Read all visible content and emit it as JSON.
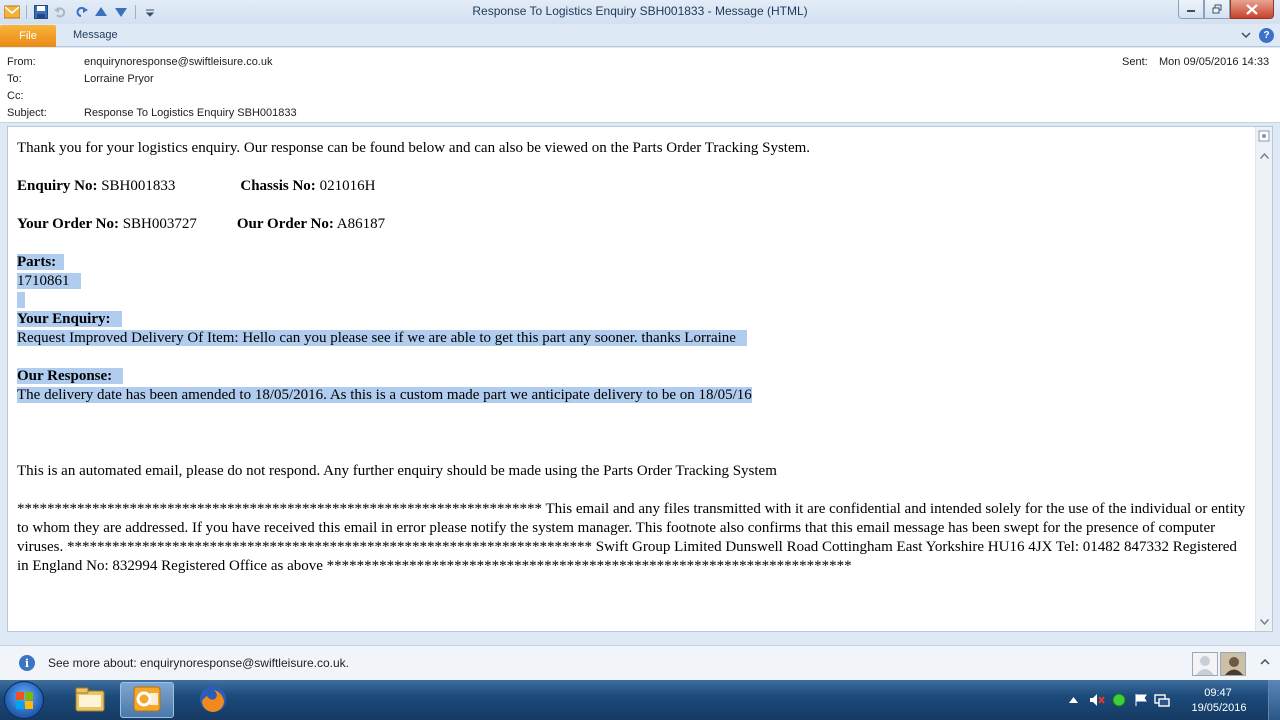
{
  "window": {
    "title": "Response To Logistics Enquiry SBH001833  -  Message (HTML)"
  },
  "ribbon": {
    "file_label": "File",
    "message_label": "Message"
  },
  "header": {
    "from_label": "From:",
    "from_value": "enquirynoresponse@swiftleisure.co.uk",
    "to_label": "To:",
    "to_value": "Lorraine Pryor",
    "cc_label": "Cc:",
    "cc_value": "",
    "subject_label": "Subject:",
    "subject_value": "Response To Logistics Enquiry SBH001833",
    "sent_label": "Sent:",
    "sent_value": "Mon 09/05/2016 14:33"
  },
  "body": {
    "intro": "Thank you for your logistics enquiry. Our response can be found below and can also be viewed on the Parts Order Tracking System.",
    "enquiry_label": "Enquiry No:",
    "enquiry_value": " SBH001833",
    "chassis_label": "Chassis No:",
    "chassis_value": " 021016H",
    "your_order_label": "Your Order No:",
    "your_order_value": " SBH003727",
    "our_order_label": "Our Order No:",
    "our_order_value": " A86187",
    "parts_label": "Parts:",
    "parts_value": "1710861",
    "your_enquiry_label": "Your Enquiry:",
    "your_enquiry_value": "Request Improved Delivery Of Item: Hello can you please see if we are able to get this part any sooner. thanks Lorraine",
    "our_response_label": "Our Response:",
    "our_response_value": "The delivery date has been amended to 18/05/2016. As this is a custom made part we anticipate delivery to be on 18/05/16",
    "automated_note": "This is an automated email, please do not respond. Any further enquiry should be made using the Parts Order Tracking System",
    "footer_text": "********************************************************************** This email and any files transmitted with it are confidential and intended solely for the use of the individual or entity to whom they are addressed. If you have received this email in error please notify the system manager. This footnote also confirms that this email message has been swept for the presence of computer viruses. ********************************************************************** Swift Group Limited Dunswell Road Cottingham East Yorkshire HU16 4JX Tel: 01482 847332 Registered in England No: 832994 Registered Office as above **********************************************************************"
  },
  "people_pane": {
    "see_more": "See more about: enquirynoresponse@swiftleisure.co.uk."
  },
  "taskbar": {
    "time": "09:47",
    "date": "19/05/2016",
    "apps": [
      "file-explorer-icon",
      "outlook-icon",
      "firefox-icon"
    ]
  },
  "colors": {
    "file_tab": "#e98a14",
    "selection": "#b0cdef",
    "taskbar": "#1c4a7a"
  }
}
